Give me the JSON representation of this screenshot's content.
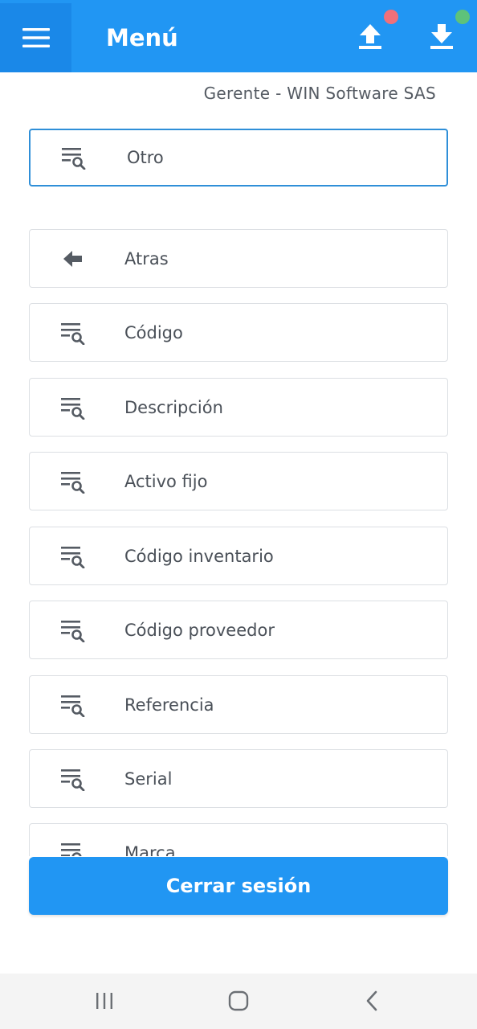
{
  "header": {
    "title": "Menú",
    "menu_icon": "hamburger-menu-icon",
    "upload_icon": "upload-icon",
    "download_icon": "download-icon",
    "upload_status_color": "#f0707a",
    "download_status_color": "#5ec27a",
    "background_color": "#2196f3"
  },
  "subtitle": "Gerente - WIN Software SAS",
  "selected_filter": {
    "label": "Otro",
    "icon": "search-list-icon"
  },
  "options": [
    {
      "label": "Atras",
      "icon": "arrow-left-icon"
    },
    {
      "label": "Código",
      "icon": "search-list-icon"
    },
    {
      "label": "Descripción",
      "icon": "search-list-icon"
    },
    {
      "label": "Activo fijo",
      "icon": "search-list-icon"
    },
    {
      "label": "Código inventario",
      "icon": "search-list-icon"
    },
    {
      "label": "Código proveedor",
      "icon": "search-list-icon"
    },
    {
      "label": "Referencia",
      "icon": "search-list-icon"
    },
    {
      "label": "Serial",
      "icon": "search-list-icon"
    },
    {
      "label": "Marca",
      "icon": "search-list-icon"
    }
  ],
  "logout": {
    "label": "Cerrar sesión"
  },
  "system_nav": {
    "recents_icon": "recents-icon",
    "home_icon": "home-icon",
    "back_icon": "back-chevron-icon"
  }
}
